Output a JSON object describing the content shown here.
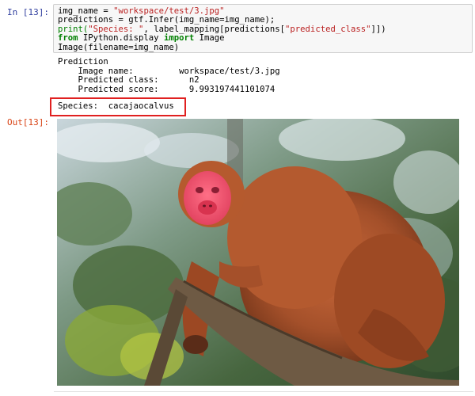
{
  "cell": {
    "in_prompt": "In [13]:",
    "out_prompt": "Out[13]:",
    "code": {
      "line1_var": "img_name = ",
      "line1_str": "\"workspace/test/3.jpg\"",
      "line2": "predictions = gtf.Infer(img_name=img_name);",
      "line3_print": "print(",
      "line3_str1": "\"Species: \"",
      "line3_mid": ", label_mapping[predictions[",
      "line3_str2": "\"predicted_class\"",
      "line3_end": "]])",
      "line4_from": "from",
      "line4_module": " IPython.display ",
      "line4_import": "import",
      "line4_name": " Image",
      "line5": "Image(filename=img_name)"
    }
  },
  "stdout": {
    "heading": "Prediction",
    "image_name_label": "    Image name:         ",
    "image_name_value": "workspace/test/3.jpg",
    "class_label": "    Predicted class:      ",
    "class_value": "n2",
    "score_label": "    Predicted score:      ",
    "score_value": "9.993197441101074"
  },
  "species": {
    "label": "Species:  ",
    "value": "cacajaocalvus"
  },
  "image": {
    "subject": "bald uakari monkey on a branch"
  }
}
